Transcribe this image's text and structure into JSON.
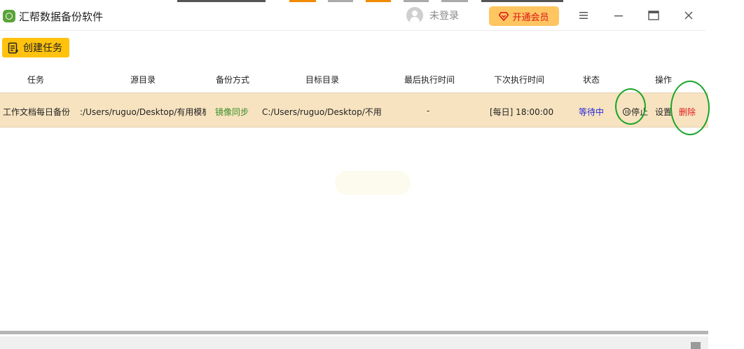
{
  "app": {
    "title": "汇帮数据备份软件",
    "logo_color": "#5aa33a"
  },
  "header": {
    "login_text": "未登录",
    "vip_label": "开通会员",
    "vip_bg": "#ffc561",
    "vip_color": "#d71818"
  },
  "window_controls": [
    "menu-icon",
    "minimize-icon",
    "maximize-icon",
    "close-icon"
  ],
  "toolbar": {
    "create_task_label": "创建任务",
    "accent": "#ffc20e"
  },
  "table": {
    "columns": [
      "任务",
      "源目录",
      "备份方式",
      "目标目录",
      "最后执行时间",
      "下次执行时间",
      "状态",
      "操作"
    ],
    "rows": [
      {
        "task": "工作文档每日备份",
        "source": ":/Users/ruguo/Desktop/有用模板",
        "mode": "镜像同步",
        "target": "C:/Users/ruguo/Desktop/不用",
        "last_run": "-",
        "next_run": "[每日] 18:00:00",
        "status": "等待中",
        "actions": {
          "stop": "停止",
          "settings": "设置",
          "delete": "删除"
        }
      }
    ],
    "row_bg": "#f7e3c0"
  }
}
